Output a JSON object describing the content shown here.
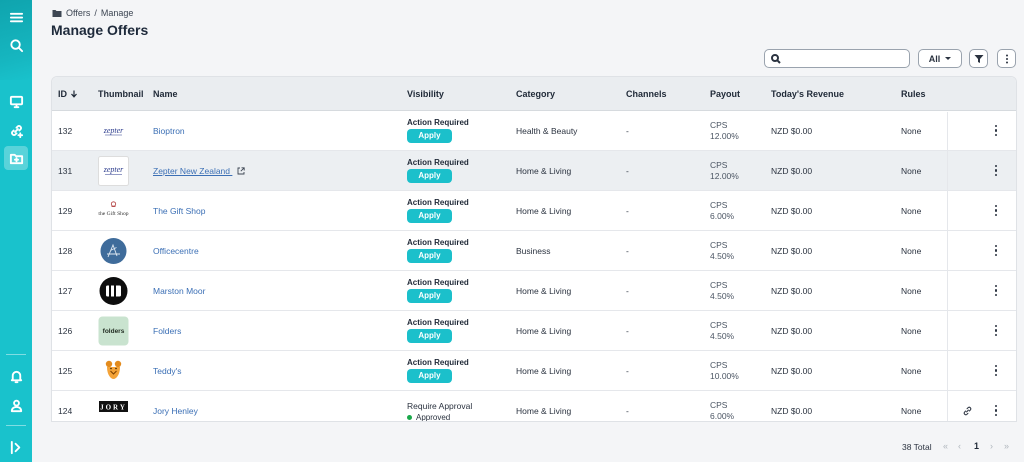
{
  "breadcrumb": {
    "root": "Offers",
    "sep": "/",
    "current": "Manage"
  },
  "page_title": "Manage Offers",
  "toolbar": {
    "search_placeholder": "",
    "filter_value": "All"
  },
  "columns": [
    "ID",
    "Thumbnail",
    "Name",
    "Visibility",
    "Category",
    "Channels",
    "Payout",
    "Today's Revenue",
    "Rules"
  ],
  "rows": [
    {
      "id": "132",
      "thumb": "zepter",
      "name": "Bioptron",
      "visibility": "Action Required",
      "action": "Apply",
      "category": "Health & Beauty",
      "channels": "-",
      "payout_type": "CPS",
      "payout": "12.00%",
      "revenue": "NZD $0.00",
      "rules": "None"
    },
    {
      "id": "131",
      "thumb": "zepter",
      "name": "Zepter New Zealand",
      "visibility": "Action Required",
      "action": "Apply",
      "category": "Home & Living",
      "channels": "-",
      "payout_type": "CPS",
      "payout": "12.00%",
      "revenue": "NZD $0.00",
      "rules": "None"
    },
    {
      "id": "129",
      "thumb": "giftshop",
      "thumb_text": "the Gift Shop",
      "name": "The Gift Shop",
      "visibility": "Action Required",
      "action": "Apply",
      "category": "Home & Living",
      "channels": "-",
      "payout_type": "CPS",
      "payout": "6.00%",
      "revenue": "NZD $0.00",
      "rules": "None"
    },
    {
      "id": "128",
      "thumb": "officecentre",
      "name": "Officecentre",
      "visibility": "Action Required",
      "action": "Apply",
      "category": "Business",
      "channels": "-",
      "payout_type": "CPS",
      "payout": "4.50%",
      "revenue": "NZD $0.00",
      "rules": "None"
    },
    {
      "id": "127",
      "thumb": "marston",
      "name": "Marston Moor",
      "visibility": "Action Required",
      "action": "Apply",
      "category": "Home & Living",
      "channels": "-",
      "payout_type": "CPS",
      "payout": "4.50%",
      "revenue": "NZD $0.00",
      "rules": "None"
    },
    {
      "id": "126",
      "thumb": "folders",
      "thumb_text": "folders",
      "name": "Folders",
      "visibility": "Action Required",
      "action": "Apply",
      "category": "Home & Living",
      "channels": "-",
      "payout_type": "CPS",
      "payout": "4.50%",
      "revenue": "NZD $0.00",
      "rules": "None"
    },
    {
      "id": "125",
      "thumb": "teddys",
      "name": "Teddy's",
      "visibility": "Action Required",
      "action": "Apply",
      "category": "Home & Living",
      "channels": "-",
      "payout_type": "CPS",
      "payout": "10.00%",
      "revenue": "NZD $0.00",
      "rules": "None"
    },
    {
      "id": "124",
      "thumb": "jory",
      "thumb_text": "JORY",
      "name": "Jory Henley",
      "visibility": "Require Approval",
      "status": "Approved",
      "category": "Home & Living",
      "channels": "-",
      "payout_type": "CPS",
      "payout": "6.00%",
      "revenue": "NZD $0.00",
      "rules": "None"
    }
  ],
  "pagination": {
    "total": "38 Total",
    "first": "«",
    "prev": "‹",
    "current_page": "1",
    "next": "›",
    "last": "»"
  },
  "colors": {
    "accent": "#19c2cc",
    "link": "#3b6fb5",
    "approved": "#1aa84a"
  }
}
